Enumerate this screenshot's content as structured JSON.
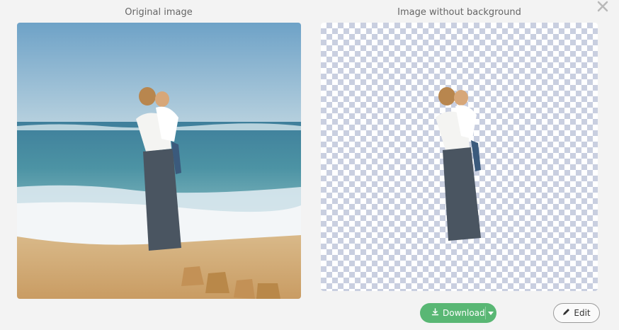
{
  "dialog": {
    "left_title": "Original image",
    "right_title": "Image without background"
  },
  "actions": {
    "download_label": "Download",
    "edit_label": "Edit"
  },
  "icons": {
    "close": "close-icon",
    "download": "download-icon",
    "dropdown": "caret-down-icon",
    "edit": "pencil-icon"
  },
  "colors": {
    "download_button": "#59b774",
    "checker": "#c9cfe0",
    "background": "#f3f3f3"
  }
}
